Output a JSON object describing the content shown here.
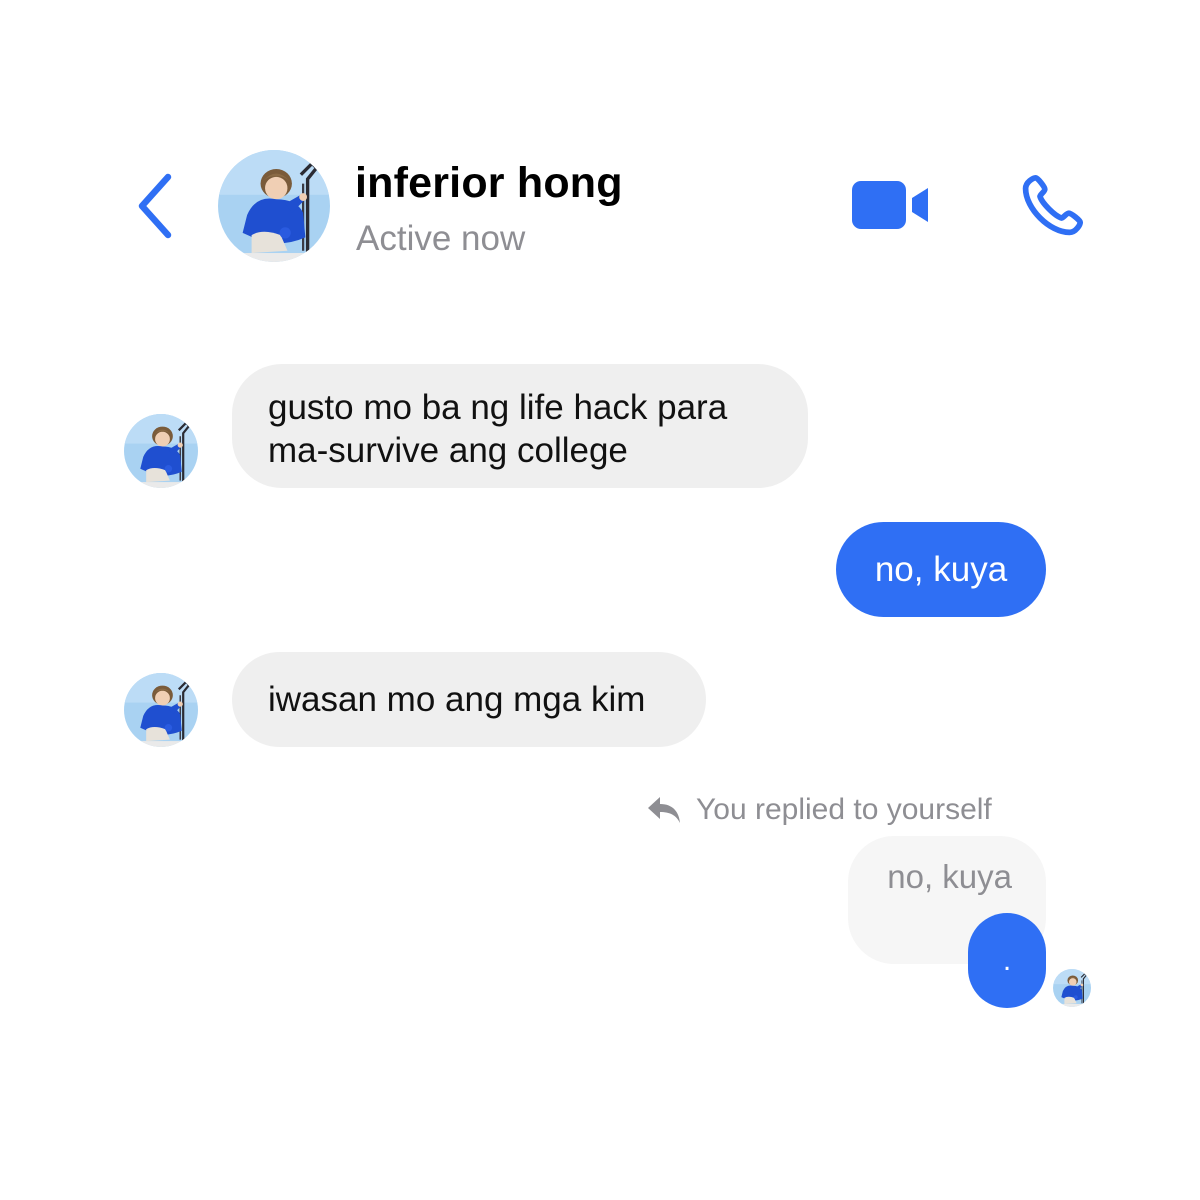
{
  "header": {
    "contact_name": "inferior hong",
    "status": "Active now",
    "icons": {
      "back": "chevron-left-icon",
      "video": "video-camera-icon",
      "call": "phone-icon"
    }
  },
  "messages": [
    {
      "from": "contact",
      "text_lines": [
        "gusto mo ba ng life hack para",
        "ma-survive ang college"
      ]
    },
    {
      "from": "me",
      "text": "no, kuya"
    },
    {
      "from": "contact",
      "text": "iwasan mo ang mga kim"
    },
    {
      "from": "me",
      "reply_note": "You replied to yourself",
      "quoted_text": "no, kuya",
      "text": "."
    }
  ],
  "colors": {
    "accent": "#2f6ff4",
    "incoming_bubble": "#efefef",
    "quoted_bubble": "#f6f6f6",
    "secondary_text": "#8e8e93"
  }
}
